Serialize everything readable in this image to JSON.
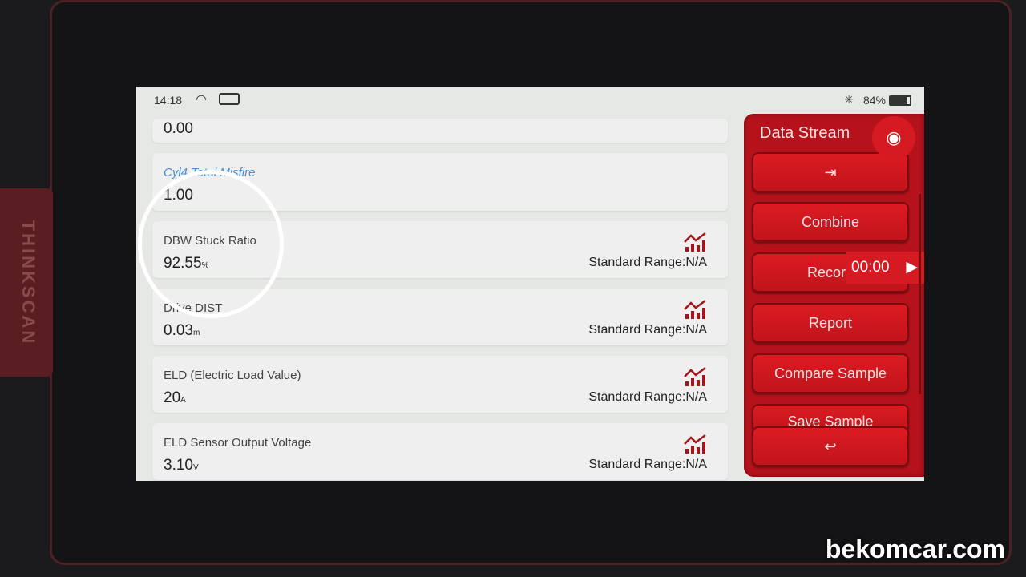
{
  "device": {
    "brand": "THINKSCAN"
  },
  "status_bar": {
    "time": "14:18",
    "bluetooth": "bluetooth-icon",
    "battery": "84%"
  },
  "rows": [
    {
      "name": "",
      "value": "0.00",
      "unit": "",
      "range": ""
    },
    {
      "name": "Cyl4 Total Misfire",
      "value": "1.00",
      "unit": "",
      "range": ""
    },
    {
      "name": "DBW Stuck Ratio",
      "value": "92.55",
      "unit": "%",
      "range": "Standard Range:N/A"
    },
    {
      "name": "Drive DIST",
      "value": "0.03",
      "unit": "m",
      "range": "Standard Range:N/A"
    },
    {
      "name": "ELD (Electric Load Value)",
      "value": "20",
      "unit": "A",
      "range": "Standard Range:N/A"
    },
    {
      "name": "ELD Sensor Output Voltage",
      "value": "3.10",
      "unit": "V",
      "range": "Standard Range:N/A"
    }
  ],
  "panel": {
    "title": "Data Stream",
    "buttons": {
      "combine": "Combine",
      "record": "Record",
      "report": "Report",
      "compare": "Compare Sample",
      "save": "Save Sample"
    },
    "timer": "00:00"
  },
  "watermark": "bekomcar.com",
  "colors": {
    "accent": "#c4141c",
    "link": "#4a8fd8"
  }
}
